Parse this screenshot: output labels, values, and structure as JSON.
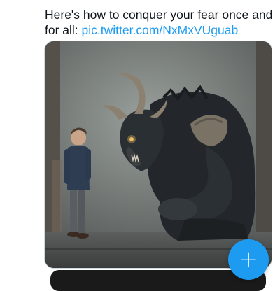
{
  "tweet": {
    "text": "Here's how to conquer your fear once and for all: ",
    "link": "pic.twitter.com/NxMxVUguab"
  },
  "media": {
    "description_icon": "image-boy-facing-horned-monster"
  },
  "compose_button": {
    "icon": "plus-icon",
    "glyph": "+"
  },
  "colors": {
    "link": "#1d9bf0",
    "fab": "#1d9bf0",
    "text": "#0f1419"
  }
}
